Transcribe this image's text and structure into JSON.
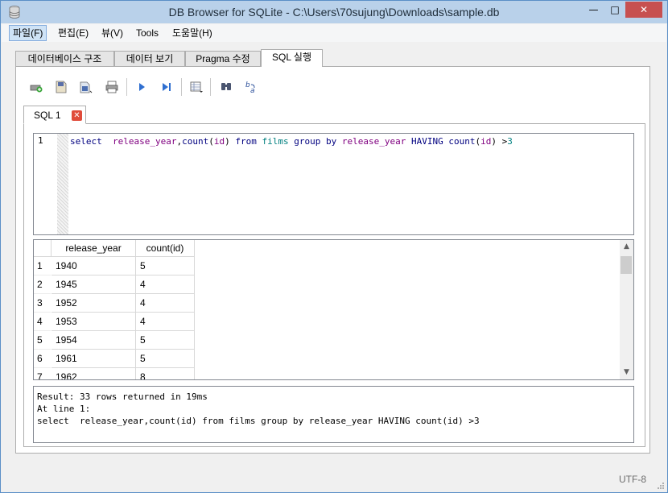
{
  "window": {
    "title": "DB Browser for SQLite - C:\\Users\\70sujung\\Downloads\\sample.db",
    "min_glyph": "—",
    "max_glyph": "□",
    "close_glyph": "✕"
  },
  "menu": [
    {
      "label": "파일(F)"
    },
    {
      "label": "편집(E)"
    },
    {
      "label": "뷰(V)"
    },
    {
      "label": "Tools"
    },
    {
      "label": "도움말(H)"
    }
  ],
  "tabs": [
    {
      "label": "데이터베이스 구조"
    },
    {
      "label": "데이터 보기"
    },
    {
      "label": "Pragma 수정"
    },
    {
      "label": "SQL 실행"
    }
  ],
  "toolbar_icons": [
    "open-tab-icon",
    "open-sql-icon",
    "save-sql-icon",
    "print-icon",
    "execute-all-icon",
    "execute-line-icon",
    "save-results-icon",
    "find-icon",
    "find-replace-icon"
  ],
  "sql_tab": {
    "label": "SQL 1",
    "close_glyph": "✕"
  },
  "editor": {
    "line_number": "1",
    "tokens": {
      "t1": "select",
      "t2": "release_year",
      "t3": ",",
      "t4": "count",
      "t5": "(",
      "t6": "id",
      "t7": ")",
      "t8": "from",
      "t9": "films",
      "t10": "group",
      "t11": "by",
      "t12": "release_year",
      "t13": "HAVING",
      "t14": "count",
      "t15": "(",
      "t16": "id",
      "t17": ")",
      "t18": ">",
      "t19": "3"
    }
  },
  "results": {
    "columns": [
      "release_year",
      "count(id)"
    ],
    "rows": [
      {
        "n": "1",
        "year": "1940",
        "count": "5"
      },
      {
        "n": "2",
        "year": "1945",
        "count": "4"
      },
      {
        "n": "3",
        "year": "1952",
        "count": "4"
      },
      {
        "n": "4",
        "year": "1953",
        "count": "4"
      },
      {
        "n": "5",
        "year": "1954",
        "count": "5"
      },
      {
        "n": "6",
        "year": "1961",
        "count": "5"
      },
      {
        "n": "7",
        "year": "1962",
        "count": "8"
      }
    ],
    "scroll_up": "▲",
    "scroll_down": "▼"
  },
  "message": {
    "line1": "Result: 33 rows returned in 19ms",
    "line2": "At line 1:",
    "line3": "select  release_year,count(id) from films group by release_year HAVING count(id) >3"
  },
  "status": {
    "encoding": "UTF-8"
  },
  "colors": {
    "keyword": "#000080",
    "identifier": "#800080",
    "table": "#008080",
    "titlebar": "#b9d1ea",
    "close": "#c75050"
  }
}
